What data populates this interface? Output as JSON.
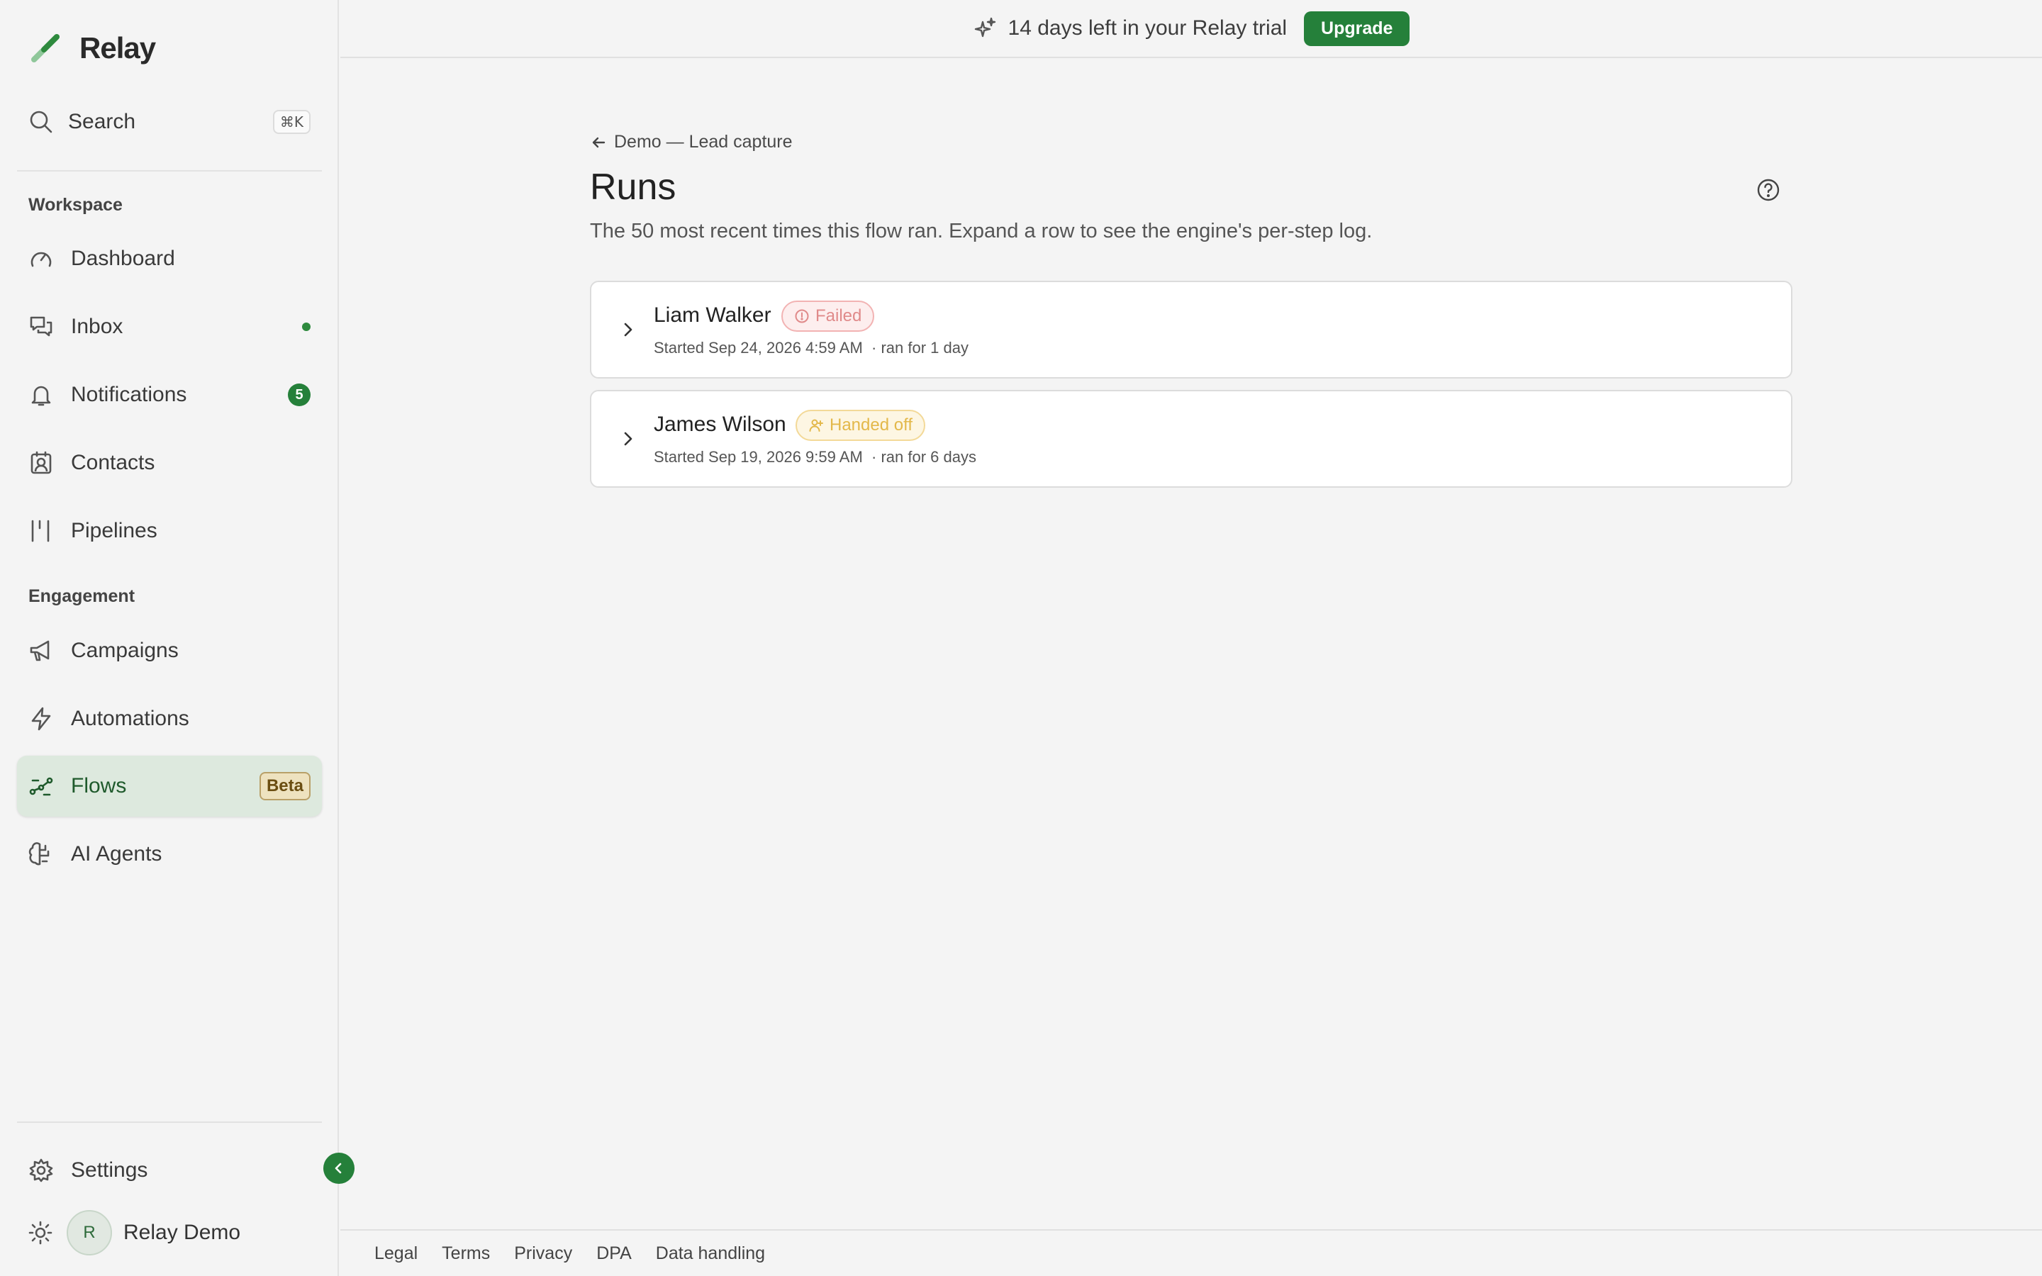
{
  "app": {
    "name": "Relay"
  },
  "sidebar": {
    "search": {
      "label": "Search",
      "shortcut": "⌘K",
      "icon": "search-icon"
    },
    "sections": {
      "workspace": "Workspace",
      "engagement": "Engagement"
    },
    "items": {
      "dashboard": {
        "label": "Dashboard",
        "icon": "gauge-icon"
      },
      "inbox": {
        "label": "Inbox",
        "icon": "chat-icon",
        "has_unread": true
      },
      "notifications": {
        "label": "Notifications",
        "icon": "bell-icon",
        "count": "5"
      },
      "contacts": {
        "label": "Contacts",
        "icon": "contact-card-icon"
      },
      "pipelines": {
        "label": "Pipelines",
        "icon": "columns-icon"
      },
      "campaigns": {
        "label": "Campaigns",
        "icon": "megaphone-icon"
      },
      "automations": {
        "label": "Automations",
        "icon": "bolt-icon"
      },
      "flows": {
        "label": "Flows",
        "icon": "flow-icon",
        "badge": "Beta",
        "active": true
      },
      "ai_agents": {
        "label": "AI Agents",
        "icon": "brain-icon"
      },
      "settings": {
        "label": "Settings",
        "icon": "gear-icon"
      }
    },
    "user": {
      "initial": "R",
      "name": "Relay Demo"
    }
  },
  "banner": {
    "text": "14 days left in your Relay trial",
    "button": "Upgrade",
    "icon": "sparkles-icon"
  },
  "page": {
    "back_label": "Demo — Lead capture",
    "title": "Runs",
    "subtitle": "The 50 most recent times this flow ran. Expand a row to see the engine's per-step log."
  },
  "runs": [
    {
      "name": "Liam Walker",
      "status": "Failed",
      "started": "Started Sep 24, 2026 4:59 AM",
      "duration": "· ran for 1 day"
    },
    {
      "name": "James Wilson",
      "status": "Handed off",
      "started": "Started Sep 19, 2026 9:59 AM",
      "duration": "· ran for 6 days"
    }
  ],
  "footer": {
    "links": [
      "Legal",
      "Terms",
      "Privacy",
      "DPA",
      "Data handling"
    ]
  },
  "colors": {
    "brand": "#25803a",
    "active_nav_bg": "#dde9de",
    "failed": "#e08a8a",
    "handed_off": "#e3b84a"
  }
}
